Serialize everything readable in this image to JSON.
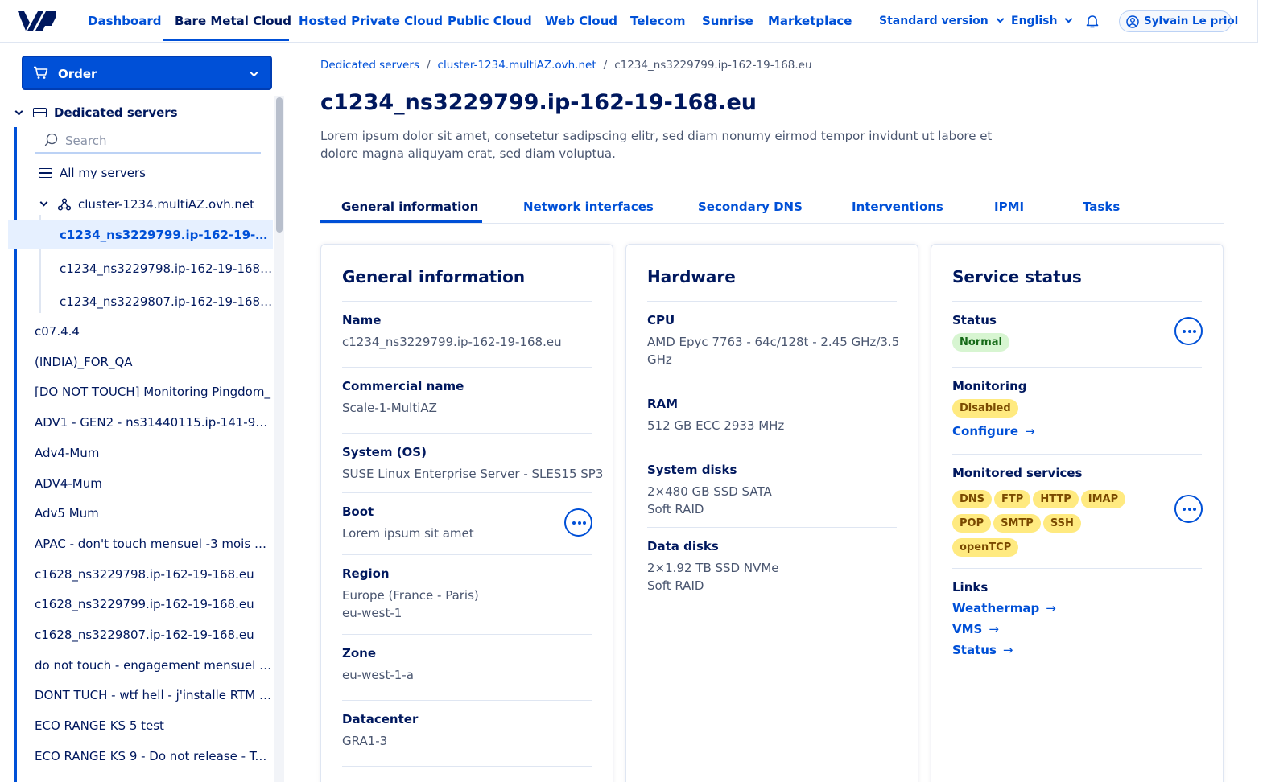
{
  "brand": {
    "accent": "#0050d7",
    "text": "#00185e"
  },
  "topnav": {
    "items": [
      "Dashboard",
      "Bare Metal Cloud",
      "Hosted Private Cloud",
      "Public Cloud",
      "Web Cloud",
      "Telecom",
      "Sunrise",
      "Marketplace"
    ],
    "active": "Bare Metal Cloud",
    "version": "Standard version",
    "language": "English",
    "user": "Sylvain Le priol"
  },
  "sidebar": {
    "order_label": "Order",
    "section": "Dedicated servers",
    "search_placeholder": "Search",
    "all_servers": "All my servers",
    "cluster": "cluster-1234.multiAZ.ovh.net",
    "cluster_children": [
      "c1234_ns3229799.ip-162-19-16...",
      "c1234_ns3229798.ip-162-19-168.eu",
      "c1234_ns3229807.ip-162-19-168.eu"
    ],
    "items": [
      "c07.4.4",
      "(INDIA)_FOR_QA",
      "[DO NOT TOUCH] Monitoring Pingdom_",
      "ADV1 - GEN2 - ns31440115.ip-141-94-1...",
      "Adv4-Mum",
      "ADV4-Mum",
      "Adv5 Mum",
      "APAC - don't touch mensuel -3 mois n...",
      "c1628_ns3229798.ip-162-19-168.eu",
      "c1628_ns3229799.ip-162-19-168.eu",
      "c1628_ns3229807.ip-162-19-168.eu",
      "do not touch - engagement mensuel d...",
      "DONT TUCH - wtf hell - j'installe RTM e...",
      "ECO RANGE KS 5 test",
      "ECO RANGE KS 9 - Do not release - Tes..."
    ]
  },
  "breadcrumb": [
    "Dedicated servers",
    "cluster-1234.multiAZ.ovh.net",
    "c1234_ns3229799.ip-162-19-168.eu"
  ],
  "page": {
    "title": "c1234_ns3229799.ip-162-19-168.eu",
    "description": "Lorem ipsum dolor sit amet, consetetur sadipscing elitr, sed diam nonumy eirmod tempor invidunt ut labore et dolore magna aliquyam erat, sed diam voluptua."
  },
  "tabs": [
    "General information",
    "Network interfaces",
    "Secondary DNS",
    "Interventions",
    "IPMI",
    "Tasks"
  ],
  "general": {
    "title": "General information",
    "fields": [
      {
        "label": "Name",
        "value": "c1234_ns3229799.ip-162-19-168.eu"
      },
      {
        "label": "Commercial name",
        "value": "Scale-1-MultiAZ"
      },
      {
        "label": "System (OS)",
        "value": "SUSE Linux Enterprise Server - SLES15 SP3"
      },
      {
        "label": "Boot",
        "value": "Lorem ipsum sit amet"
      },
      {
        "label": "Region",
        "value": "Europe (France - Paris)",
        "value2": "eu-west-1"
      },
      {
        "label": "Zone",
        "value": "eu-west-1-a"
      },
      {
        "label": "Datacenter",
        "value": "GRA1-3"
      }
    ]
  },
  "hardware": {
    "title": "Hardware",
    "fields": [
      {
        "label": "CPU",
        "value": "AMD Epyc 7763 - 64c/128t - 2.45 GHz/3.5",
        "value2": "GHz"
      },
      {
        "label": "RAM",
        "value": "512 GB ECC 2933 MHz"
      },
      {
        "label": "System disks",
        "value": "2×480 GB SSD SATA",
        "value2": "Soft RAID"
      },
      {
        "label": "Data disks",
        "value": "2×1.92 TB SSD NVMe",
        "value2": "Soft RAID"
      }
    ]
  },
  "status": {
    "title": "Service status",
    "status_label": "Status",
    "status_value": "Normal",
    "monitoring_label": "Monitoring",
    "monitoring_value": "Disabled",
    "configure": "Configure",
    "monitored_label": "Monitored services",
    "services": [
      "DNS",
      "FTP",
      "HTTP",
      "IMAP",
      "POP",
      "SMTP",
      "SSH",
      "openTCP"
    ],
    "links_label": "Links",
    "links": [
      "Weathermap",
      "VMS",
      "Status"
    ]
  }
}
